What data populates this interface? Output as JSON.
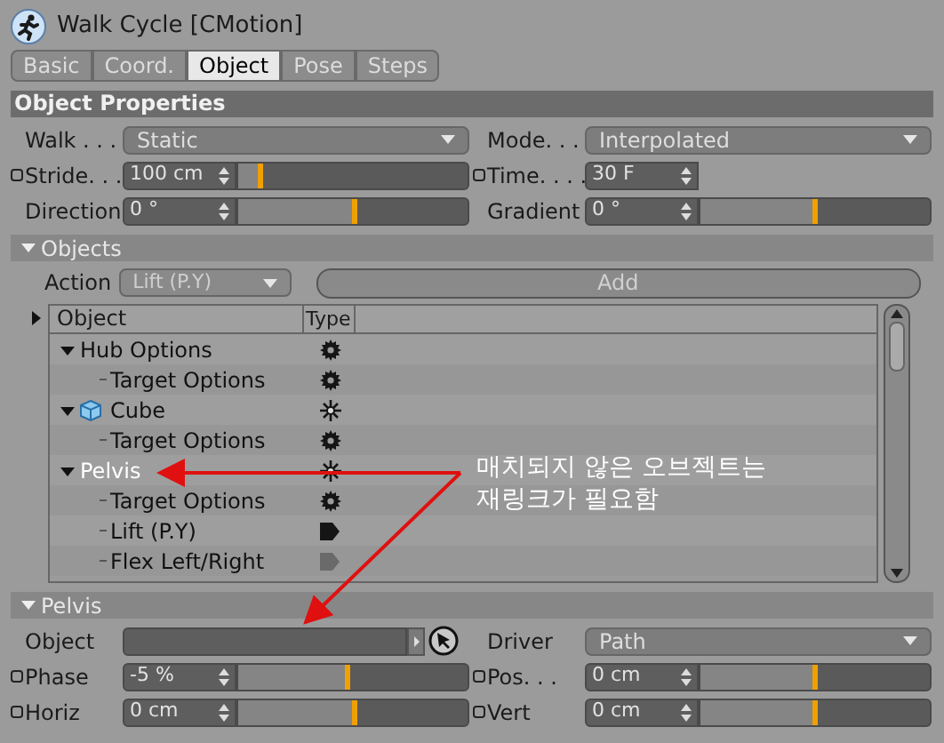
{
  "window": {
    "title": "Walk Cycle [CMotion]"
  },
  "tabs": [
    {
      "label": "Basic",
      "selected": false
    },
    {
      "label": "Coord.",
      "selected": false
    },
    {
      "label": "Object",
      "selected": true
    },
    {
      "label": "Pose",
      "selected": false
    },
    {
      "label": "Steps",
      "selected": false
    }
  ],
  "object_properties": {
    "title": "Object Properties",
    "rows": [
      [
        {
          "label": "Walk . . .",
          "kind": "dropdown",
          "value": "Static",
          "animatable": false
        },
        {
          "label": "Mode. . .",
          "kind": "dropdown",
          "value": "Interpolated",
          "animatable": false
        }
      ],
      [
        {
          "label": "Stride. . .",
          "kind": "number",
          "value": "100 cm",
          "level": 0.11,
          "animatable": true
        },
        {
          "label": "Time. . . .",
          "kind": "number",
          "value": "30 F",
          "animatable": true
        }
      ],
      [
        {
          "label": "Direction",
          "kind": "number",
          "value": "0 °",
          "level": 0.52,
          "animatable": false
        },
        {
          "label": "Gradient",
          "kind": "number",
          "value": "0 °",
          "level": 0.51,
          "animatable": false
        }
      ]
    ]
  },
  "objects": {
    "title": "Objects",
    "action_label": "Action",
    "action_value": "Lift (P.Y)",
    "add_button": "Add",
    "columns": [
      "Object",
      "Type"
    ],
    "tree": [
      {
        "label": "Hub Options",
        "kind": "gear",
        "expanded": true,
        "selected": false,
        "children": [
          {
            "label": "Target Options",
            "kind": "gear",
            "selected": false
          }
        ]
      },
      {
        "label": "Cube",
        "kind": "joint",
        "cube_icon": true,
        "expanded": true,
        "selected": false,
        "children": [
          {
            "label": "Target Options",
            "kind": "gear",
            "selected": false
          }
        ]
      },
      {
        "label": "Pelvis",
        "kind": "joint",
        "expanded": true,
        "selected": true,
        "children": [
          {
            "label": "Target Options",
            "kind": "gear",
            "selected": false
          },
          {
            "label": "Lift (P.Y)",
            "kind": "tag",
            "selected": false
          },
          {
            "label": "Flex Left/Right",
            "kind": "tag",
            "selected": false
          }
        ]
      }
    ]
  },
  "pelvis": {
    "title": "Pelvis",
    "rows": [
      [
        {
          "label": "Object",
          "kind": "link",
          "animatable": false
        },
        {
          "label": "Driver",
          "kind": "dropdown",
          "value": "Path",
          "animatable": false
        }
      ],
      [
        {
          "label": "Phase",
          "kind": "number",
          "value": "-5 %",
          "level": 0.49,
          "animatable": true
        },
        {
          "label": "Pos. . .",
          "kind": "number",
          "value": "0 cm",
          "level": 0.51,
          "animatable": true
        }
      ],
      [
        {
          "label": "Horiz",
          "kind": "number",
          "value": "0 cm",
          "level": 0.52,
          "animatable": true
        },
        {
          "label": "Vert",
          "kind": "number",
          "value": "0 cm",
          "level": 0.51,
          "animatable": true
        }
      ]
    ]
  },
  "annotation": {
    "text": "매치되지 않은 오브젝트는\n재링크가 필요함"
  }
}
